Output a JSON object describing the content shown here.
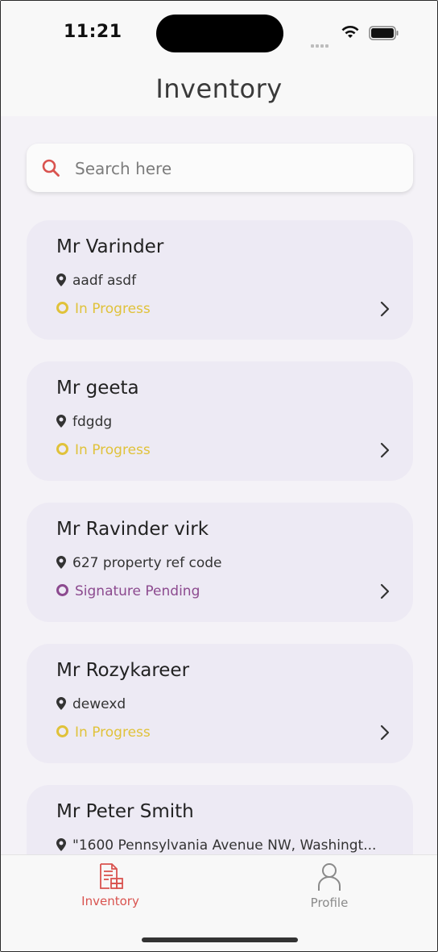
{
  "status_bar": {
    "time": "11:21"
  },
  "header": {
    "title": "Inventory"
  },
  "search": {
    "placeholder": "Search here"
  },
  "cards": [
    {
      "name": "Mr Varinder",
      "address": "aadf asdf",
      "status": "In Progress",
      "status_color": "#e0c23a"
    },
    {
      "name": "Mr geeta",
      "address": "fdgdg",
      "status": "In Progress",
      "status_color": "#e0c23a"
    },
    {
      "name": "Mr Ravinder virk",
      "address": "627 property ref code",
      "status": "Signature Pending",
      "status_color": "#8c4a8f"
    },
    {
      "name": "Mr Rozykareer",
      "address": "dewexd",
      "status": "In Progress",
      "status_color": "#e0c23a"
    },
    {
      "name": "Mr Peter Smith",
      "address": "\"1600 Pennsylvania Avenue NW, Washingt...",
      "status": "",
      "status_color": "#e0c23a"
    }
  ],
  "bottom_nav": {
    "items": [
      {
        "label": "Inventory",
        "icon": "inventory-icon",
        "active": true
      },
      {
        "label": "Profile",
        "icon": "profile-icon",
        "active": false
      }
    ],
    "active_color": "#d9534f",
    "inactive_color": "#8a8a8a"
  }
}
